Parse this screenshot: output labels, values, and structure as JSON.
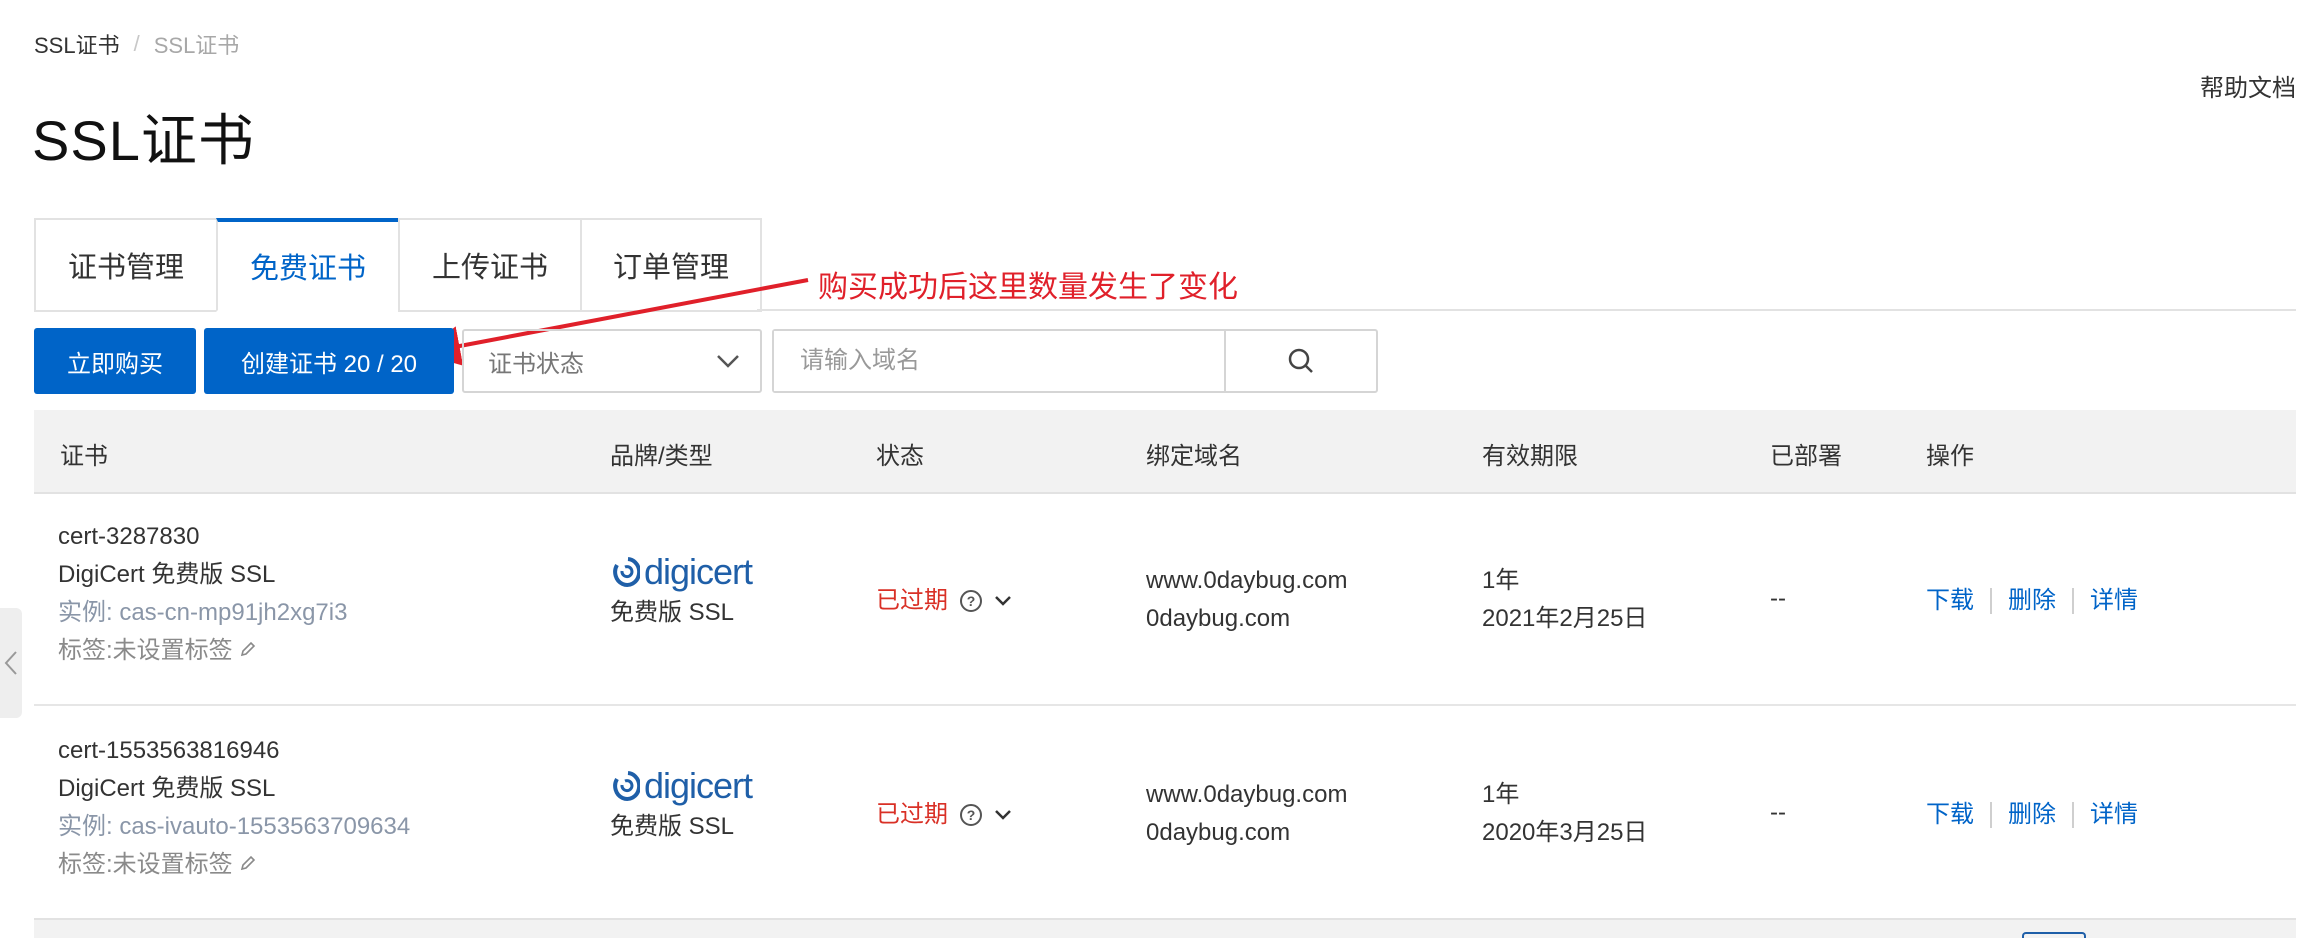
{
  "breadcrumb": {
    "root": "SSL证书",
    "separator": "/",
    "current": "SSL证书"
  },
  "header": {
    "title": "SSL证书",
    "help": "帮助文档"
  },
  "tabs": [
    {
      "label": "证书管理",
      "active": false
    },
    {
      "label": "免费证书",
      "active": true
    },
    {
      "label": "上传证书",
      "active": false
    },
    {
      "label": "订单管理",
      "active": false
    }
  ],
  "annotation": {
    "text": "购买成功后这里数量发生了变化",
    "color": "#e0202a"
  },
  "toolbar": {
    "buy_label": "立即购买",
    "create_label": "创建证书 20 / 20",
    "status_select": "证书状态",
    "search_placeholder": "请输入域名"
  },
  "table": {
    "columns": [
      "证书",
      "品牌/类型",
      "状态",
      "绑定域名",
      "有效期限",
      "已部署",
      "操作"
    ],
    "rows": [
      {
        "cert_id": "cert-3287830",
        "cert_name": "DigiCert 免费版 SSL",
        "instance": "实例: cas-cn-mp91jh2xg7i3",
        "tag": "标签:未设置标签",
        "brand": "digicert",
        "brand_type": "免费版 SSL",
        "status": "已过期",
        "domains": [
          "www.0daybug.com",
          "0daybug.com"
        ],
        "validity": "1年",
        "expire_date": "2021年2月25日",
        "deployed": "--",
        "ops": [
          "下载",
          "删除",
          "详情"
        ]
      },
      {
        "cert_id": "cert-1553563816946",
        "cert_name": "DigiCert 免费版 SSL",
        "instance": "实例: cas-ivauto-1553563709634",
        "tag": "标签:未设置标签",
        "brand": "digicert",
        "brand_type": "免费版 SSL",
        "status": "已过期",
        "domains": [
          "www.0daybug.com",
          "0daybug.com"
        ],
        "validity": "1年",
        "expire_date": "2020年3月25日",
        "deployed": "--",
        "ops": [
          "下载",
          "删除",
          "详情"
        ]
      }
    ]
  },
  "colors": {
    "primary": "#0064c8",
    "expired": "#d93026",
    "instance": "#8a96a8"
  }
}
